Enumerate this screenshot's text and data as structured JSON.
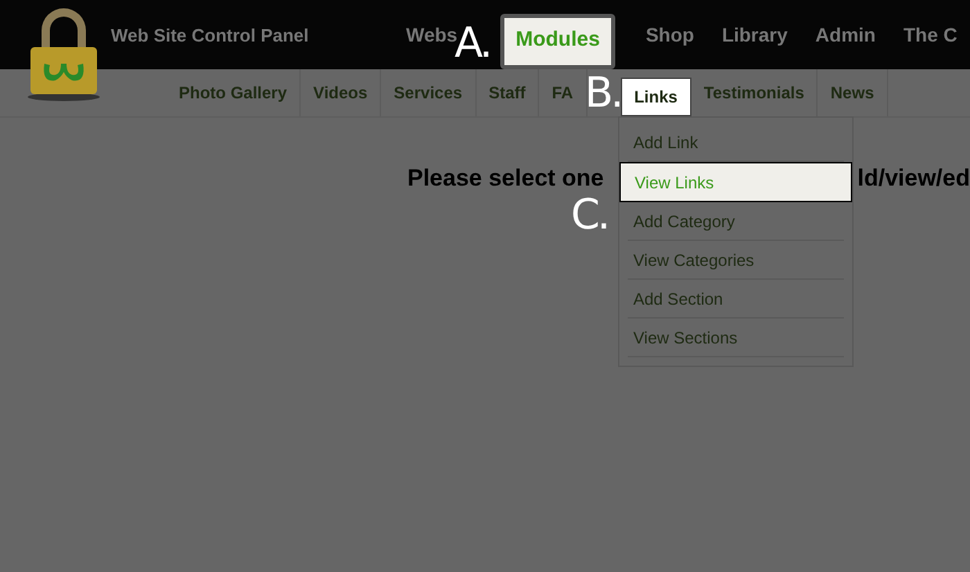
{
  "header": {
    "title": "Web Site Control Panel"
  },
  "main_nav": [
    {
      "label": "Webs",
      "selected": false
    },
    {
      "label": "Modules",
      "selected": true
    },
    {
      "label": "Shop",
      "selected": false
    },
    {
      "label": "Library",
      "selected": false
    },
    {
      "label": "Admin",
      "selected": false
    },
    {
      "label": "The C",
      "selected": false
    }
  ],
  "sub_nav": [
    {
      "label": "Photo Gallery",
      "selected": false
    },
    {
      "label": "Videos",
      "selected": false
    },
    {
      "label": "Services",
      "selected": false
    },
    {
      "label": "Staff",
      "selected": false
    },
    {
      "label": "FA",
      "selected": false
    },
    {
      "label": "Links",
      "selected": true
    },
    {
      "label": "Testimonials",
      "selected": false
    },
    {
      "label": "News",
      "selected": false
    }
  ],
  "dropdown": [
    {
      "label": "Add Link",
      "selected": false
    },
    {
      "label": "View Links",
      "selected": true
    },
    {
      "label": "Add Category",
      "selected": false
    },
    {
      "label": "View Categories",
      "selected": false
    },
    {
      "label": "Add Section",
      "selected": false
    },
    {
      "label": "View Sections",
      "selected": false
    }
  ],
  "message": {
    "start": "Please select one",
    "end": "ld/view/ed"
  },
  "callouts": [
    "A.",
    "B.",
    "C."
  ]
}
